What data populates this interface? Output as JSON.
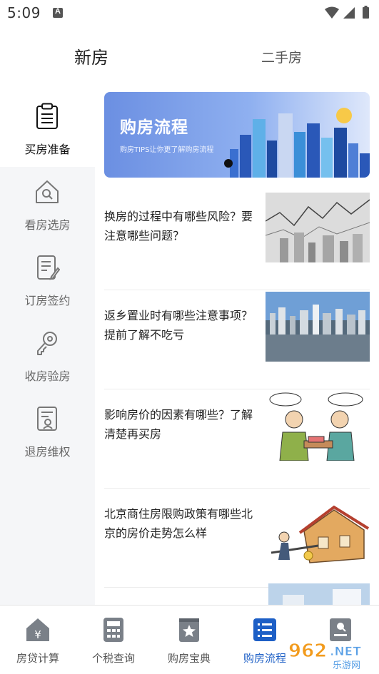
{
  "status_bar": {
    "time": "5:09"
  },
  "top_tabs": [
    {
      "label": "新房",
      "active": true
    },
    {
      "label": "二手房",
      "active": false
    }
  ],
  "sidebar": {
    "items": [
      {
        "label": "买房准备",
        "icon": "clipboard-icon",
        "active": true
      },
      {
        "label": "看房选房",
        "icon": "house-search-icon",
        "active": false
      },
      {
        "label": "订房签约",
        "icon": "document-sign-icon",
        "active": false
      },
      {
        "label": "收房验房",
        "icon": "key-icon",
        "active": false
      },
      {
        "label": "退房维权",
        "icon": "certificate-icon",
        "active": false
      }
    ]
  },
  "banner": {
    "title": "购房流程",
    "subtitle": "购房TIPS让你更了解购房流程"
  },
  "articles": [
    {
      "title": "换房的过程中有哪些风险？要注意哪些问题？"
    },
    {
      "title": "返乡置业时有哪些注意事项？提前了解不吃亏"
    },
    {
      "title": "影响房价的因素有哪些？了解清楚再买房"
    },
    {
      "title": "北京商住房限购政策有哪些北京的房价走势怎么样"
    }
  ],
  "bottom_nav": [
    {
      "label": "房贷计算",
      "icon": "loan-calculator-icon",
      "active": false
    },
    {
      "label": "个税查询",
      "icon": "calculator-icon",
      "active": false
    },
    {
      "label": "购房宝典",
      "icon": "star-book-icon",
      "active": false
    },
    {
      "label": "购房流程",
      "icon": "list-icon",
      "active": true
    },
    {
      "label": "",
      "icon": "profile-icon",
      "active": false
    }
  ],
  "watermark": {
    "text": "962.NET",
    "subtext": "乐游网"
  },
  "colors": {
    "accent": "#1d5fc6",
    "sidebar_bg": "#f5f6f8",
    "banner": "#6b8fe2"
  }
}
